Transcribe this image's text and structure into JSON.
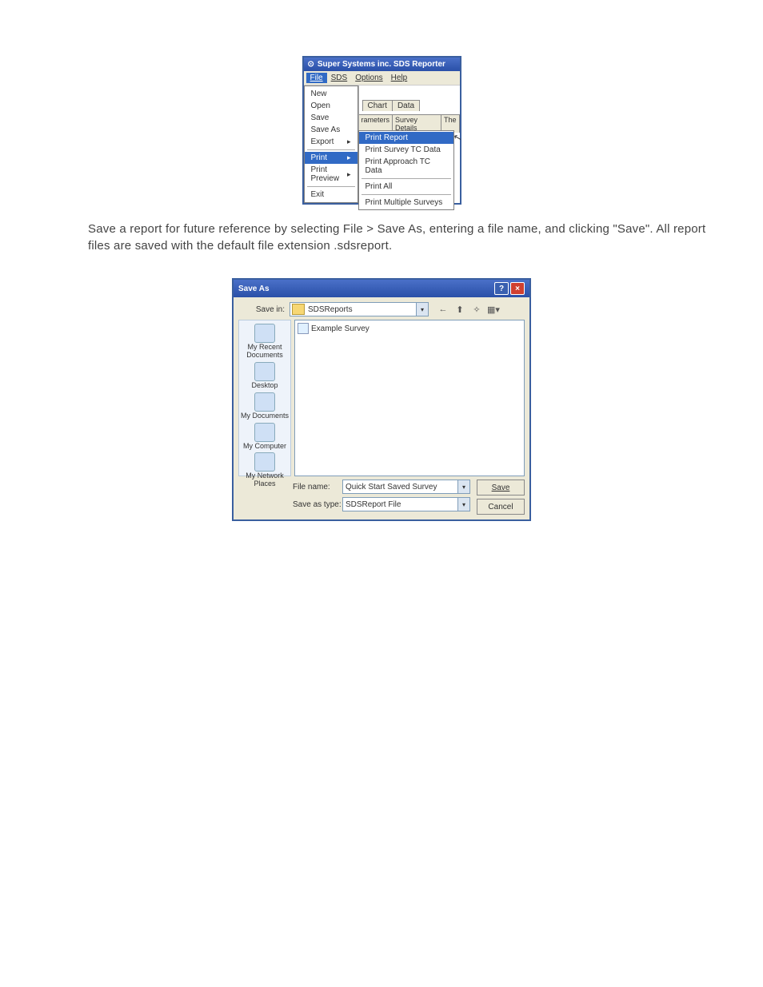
{
  "win1": {
    "title": "Super Systems inc. SDS Reporter",
    "menubar": [
      "File",
      "SDS",
      "Options",
      "Help"
    ],
    "file_menu": [
      "New",
      "Open",
      "Save",
      "Save As",
      "Export",
      "Print",
      "Print Preview",
      "Exit"
    ],
    "tabs_top": [
      "Chart",
      "Data"
    ],
    "tabs_sub": [
      "rameters",
      "Survey Details",
      "The"
    ],
    "print_submenu": [
      "Print Report",
      "Print Survey TC Data",
      "Print Approach TC Data",
      "Print All",
      "Print Multiple Surveys"
    ]
  },
  "instruction": "Save a report for future reference by selecting File > Save As, entering a file name, and clicking \"Save\". All report files are saved with the default file extension .sdsreport.",
  "dlg": {
    "title": "Save As",
    "save_in_label": "Save in:",
    "save_in_value": "SDSReports",
    "places": [
      "My Recent Documents",
      "Desktop",
      "My Documents",
      "My Computer",
      "My Network Places"
    ],
    "file_item": "Example Survey",
    "filename_label": "File name:",
    "filename_value": "Quick Start Saved Survey",
    "saveastype_label": "Save as type:",
    "saveastype_value": "SDSReport File",
    "save_btn": "Save",
    "cancel_btn": "Cancel"
  }
}
